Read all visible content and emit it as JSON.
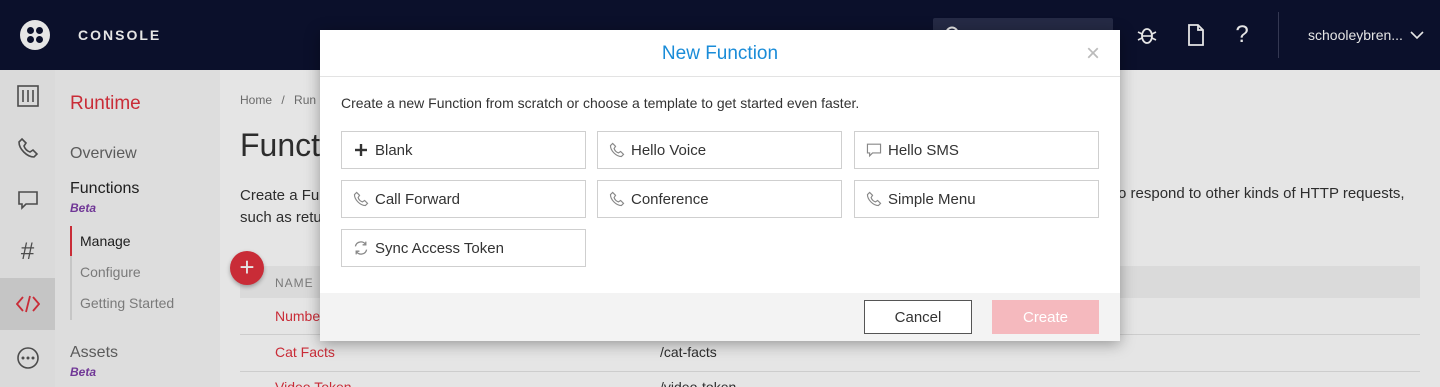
{
  "app": {
    "brand": "CONSOLE",
    "account": "schooleybren..."
  },
  "rail": {
    "icons": [
      "dashboard-icon",
      "phone-icon",
      "chat-icon",
      "hash-icon",
      "code-icon",
      "more-icon"
    ],
    "active": "code-icon"
  },
  "sidenav": {
    "title": "Runtime",
    "overview": "Overview",
    "functions": "Functions",
    "functions_badge": "Beta",
    "manage": "Manage",
    "configure": "Configure",
    "getting_started": "Getting Started",
    "assets": "Assets",
    "assets_badge": "Beta"
  },
  "main": {
    "breadcrumb_home": "Home",
    "breadcrumb_sep": "/",
    "breadcrumb_next": "Run",
    "title": "Funct",
    "description_line1": "Create a Fun",
    "description_line2": "such as retu",
    "description_right": "o respond to other kinds of HTTP requests,",
    "table_header_name": "NAME",
    "rows": [
      {
        "name": "Numbe",
        "path": ""
      },
      {
        "name": "Cat Facts",
        "path": "/cat-facts"
      },
      {
        "name": "Video Token",
        "path": "/video-token"
      }
    ]
  },
  "modal": {
    "title": "New Function",
    "close": "×",
    "intro": "Create a new Function from scratch or choose a template to get started even faster.",
    "templates": [
      {
        "label": "Blank",
        "icon": "plus-icon"
      },
      {
        "label": "Hello Voice",
        "icon": "phone-icon"
      },
      {
        "label": "Hello SMS",
        "icon": "chat-icon"
      },
      {
        "label": "Call Forward",
        "icon": "phone-icon"
      },
      {
        "label": "Conference",
        "icon": "phone-icon"
      },
      {
        "label": "Simple Menu",
        "icon": "phone-icon"
      },
      {
        "label": "Sync Access Token",
        "icon": "sync-icon"
      }
    ],
    "cancel": "Cancel",
    "create": "Create"
  },
  "colors": {
    "brand_red": "#e0313e",
    "topbar": "#0d1230",
    "modal_title": "#1a8cd8",
    "create_disabled": "#f5b9be"
  }
}
